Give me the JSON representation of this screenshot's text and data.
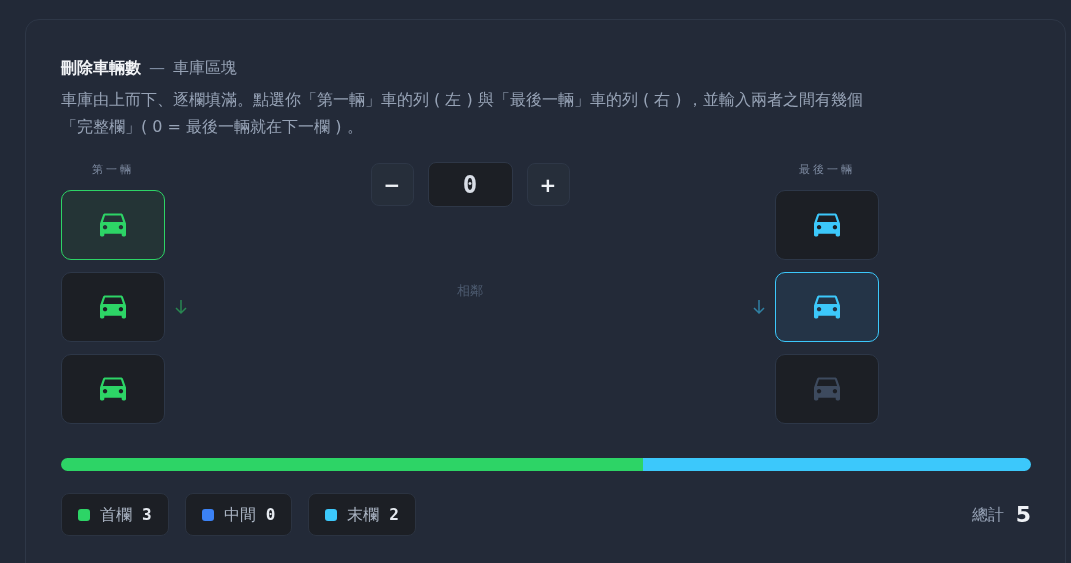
{
  "title": "刪除車輛數",
  "title_dash": "—",
  "subtitle": "車庫區塊",
  "description": "車庫由上而下、逐欄填滿。點選你「第一輛」車的列 ( 左 ) 與「最後一輛」車的列 ( 右 ) ，並輸入兩者之間有幾個「完整欄」( 0 = 最後一輛就在下一欄 ) 。",
  "left": {
    "label": "第一輛",
    "color": "#2dd466",
    "rows": [
      {
        "selected": true,
        "filled": true,
        "arrow": false
      },
      {
        "selected": false,
        "filled": true,
        "arrow": true
      },
      {
        "selected": false,
        "filled": true,
        "arrow": false
      }
    ]
  },
  "stepper": {
    "minus": "−",
    "value": "0",
    "plus": "+"
  },
  "middle_note": "相鄰",
  "right": {
    "label": "最後一輛",
    "color": "#3cc8fb",
    "rows": [
      {
        "selected": false,
        "filled": true,
        "arrow": false
      },
      {
        "selected": true,
        "filled": true,
        "arrow": true
      },
      {
        "selected": false,
        "filled": false,
        "arrow": false
      }
    ]
  },
  "bar": [
    {
      "color": "#2dd466",
      "level": 0.6
    },
    {
      "color": "#3cc8fb",
      "level": 0.4
    }
  ],
  "legend": [
    {
      "label": "首欄",
      "count": "3",
      "color": "#2dd466"
    },
    {
      "label": "中間",
      "count": "0",
      "color": "#3b82f6"
    },
    {
      "label": "末欄",
      "count": "2",
      "color": "#3cc8fb"
    }
  ],
  "total": {
    "label": "總計",
    "value": "5"
  }
}
